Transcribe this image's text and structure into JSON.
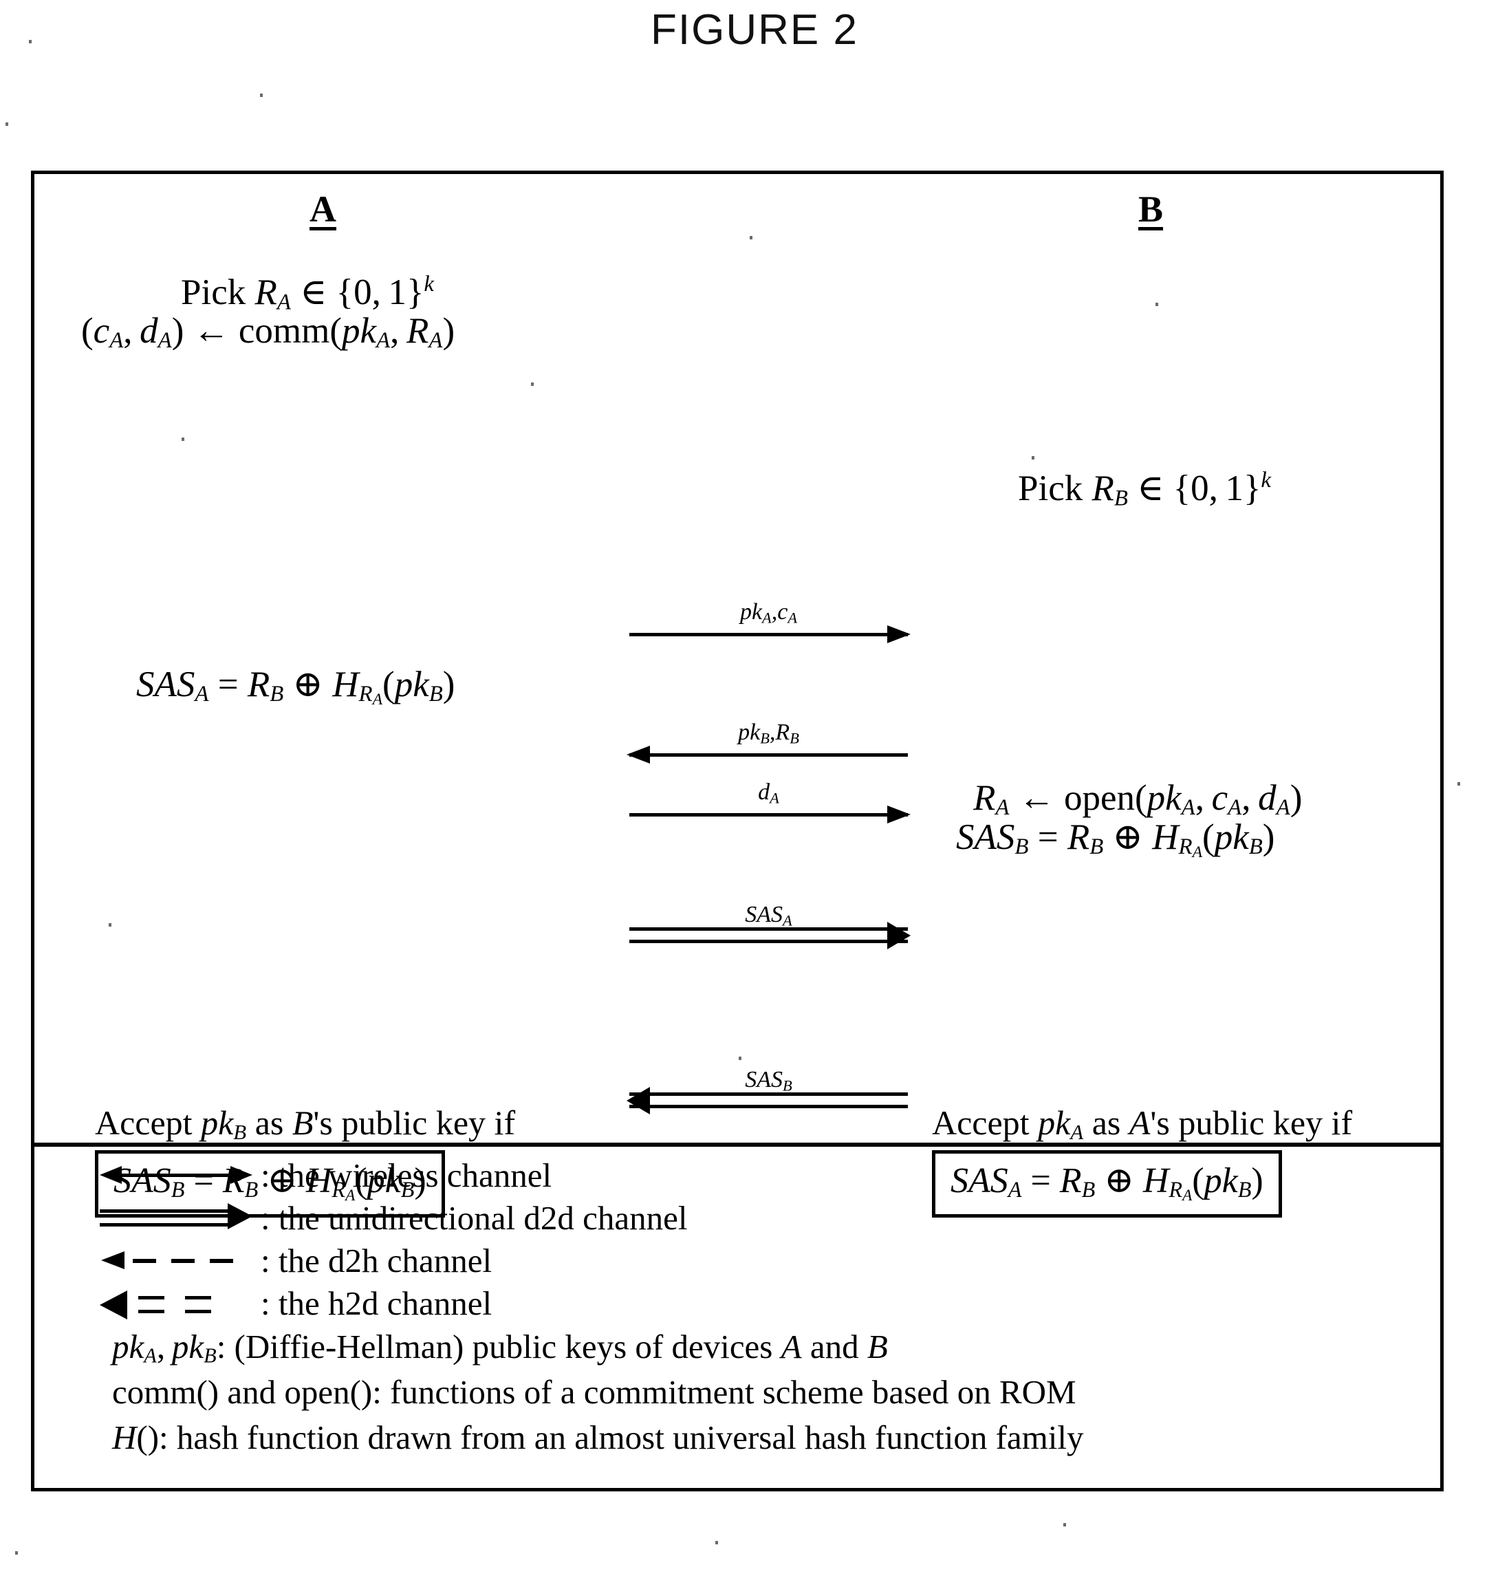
{
  "figure": {
    "title": "FIGURE 2"
  },
  "parties": {
    "left": "A",
    "right": "B"
  },
  "left_column": {
    "pick": "Pick R_A ∈ {0,1}^k",
    "pick_parts": {
      "prefix": "Pick ",
      "var": "R",
      "sub": "A",
      "set": " ∈ {0, 1}",
      "sup": "k"
    },
    "commit": "(c_A, d_A) ← comm(pk_A, R_A)",
    "sas": "SAS_A = R_B ⊕ H_{R_A}(pk_B)",
    "accept_text": "Accept pk_B as B's public key if",
    "accept_equation": "SAS_B = R_B ⊕ H_{R_A}(pk_B)"
  },
  "right_column": {
    "pick": "Pick R_B ∈ {0,1}^k",
    "open": "R_A ← open(pk_A, c_A, d_A)",
    "sas": "SAS_B = R_B ⊕ H_{R_A}(pk_B)",
    "accept_text": "Accept pk_A as A's public key if",
    "accept_equation": "SAS_A = R_B ⊕ H_{R_A}(pk_B)"
  },
  "messages": [
    {
      "id": "m1",
      "label": "pk_A, c_A",
      "direction": "right",
      "style": "single",
      "channel": "wireless"
    },
    {
      "id": "m2",
      "label": "pk_B, R_B",
      "direction": "left",
      "style": "single",
      "channel": "wireless"
    },
    {
      "id": "m3",
      "label": "d_A",
      "direction": "right",
      "style": "single",
      "channel": "wireless"
    },
    {
      "id": "m4",
      "label": "SAS_A",
      "direction": "right",
      "style": "double",
      "channel": "d2d"
    },
    {
      "id": "m5",
      "label": "SAS_B",
      "direction": "left",
      "style": "double",
      "channel": "d2d"
    }
  ],
  "legend": {
    "rows": [
      {
        "glyph": "wireless-arrow-icon",
        "text": ": the wireless channel"
      },
      {
        "glyph": "d2d-arrow-icon",
        "text": ": the unidirectional d2d channel"
      },
      {
        "glyph": "d2h-arrow-icon",
        "text": ": the d2h channel"
      },
      {
        "glyph": "h2d-arrow-icon",
        "text": ": the h2d channel"
      }
    ],
    "notes": [
      "pk_A, pk_B: (Diffie-Hellman) public keys of devices A and B",
      "comm() and open(): functions of a commitment scheme based on ROM",
      "H(): hash function drawn from an almost universal hash function family"
    ]
  },
  "colors": {
    "ink": "#000000",
    "paper": "#ffffff"
  }
}
